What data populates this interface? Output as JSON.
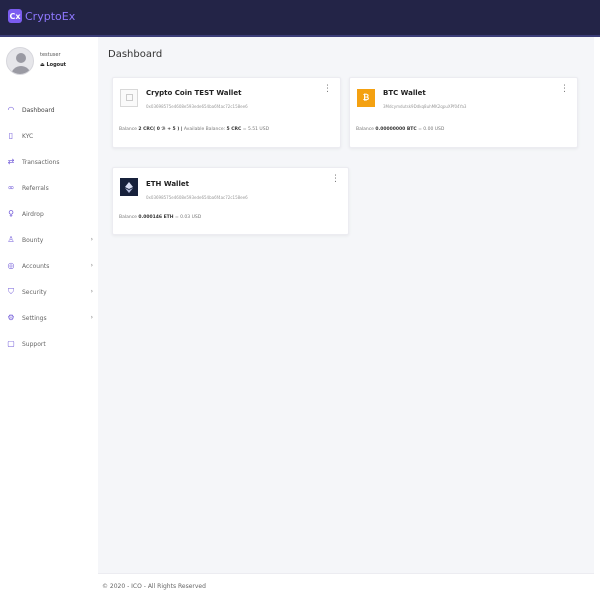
{
  "app": {
    "brand_logo": "Cx",
    "brand_name": "CryptoEx"
  },
  "user": {
    "name": "testuser",
    "logout_label": "Logout"
  },
  "sidebar": {
    "items": [
      {
        "label": "Dashboard",
        "icon": "dashboard-icon"
      },
      {
        "label": "KYC",
        "icon": "kyc-icon"
      },
      {
        "label": "Transactions",
        "icon": "transactions-icon"
      },
      {
        "label": "Referrals",
        "icon": "referrals-icon"
      },
      {
        "label": "Airdrop",
        "icon": "airdrop-icon"
      },
      {
        "label": "Bounty",
        "icon": "bounty-icon",
        "chevron": "›"
      },
      {
        "label": "Accounts",
        "icon": "accounts-icon",
        "chevron": "›"
      },
      {
        "label": "Security",
        "icon": "security-icon",
        "chevron": "›"
      },
      {
        "label": "Settings",
        "icon": "settings-icon",
        "chevron": "›"
      },
      {
        "label": "Support",
        "icon": "support-icon"
      }
    ]
  },
  "main": {
    "title": "Dashboard",
    "wallets": [
      {
        "title": "Crypto Coin TEST Wallet",
        "address": "0x03698575e4608e593ede654ba6f4ac72c158ee6",
        "balance_label": "Balance",
        "balance_value": "2 CRC( 0 ℬ + 5 )",
        "separator": "|",
        "available_label": "Available Balance:",
        "available_value": "5 CRC",
        "available_usd": "= 5.51 USD",
        "menu": "⋮"
      },
      {
        "title": "BTC Wallet",
        "address": "3Mdcymdutsk9Ddkq8uhMK2qpuXPf04Ya3",
        "balance_label": "Balance",
        "balance_value": "0.00000000 BTC",
        "balance_usd": "= 0.00 USD",
        "menu": "⋮"
      },
      {
        "title": "ETH Wallet",
        "address": "0x03698575e4608e593ede654ba6f4ac72c158ee6",
        "balance_label": "Balance",
        "balance_value": "0.000146 ETH",
        "balance_usd": "= 0.03 USD",
        "menu": "⋮"
      }
    ]
  },
  "footer": {
    "text": "© 2020 - ICO - All Rights Reserved"
  },
  "colors": {
    "topbar": "#232447",
    "accent": "#6e57d8",
    "btc": "#f4a111",
    "eth": "#17213b"
  }
}
